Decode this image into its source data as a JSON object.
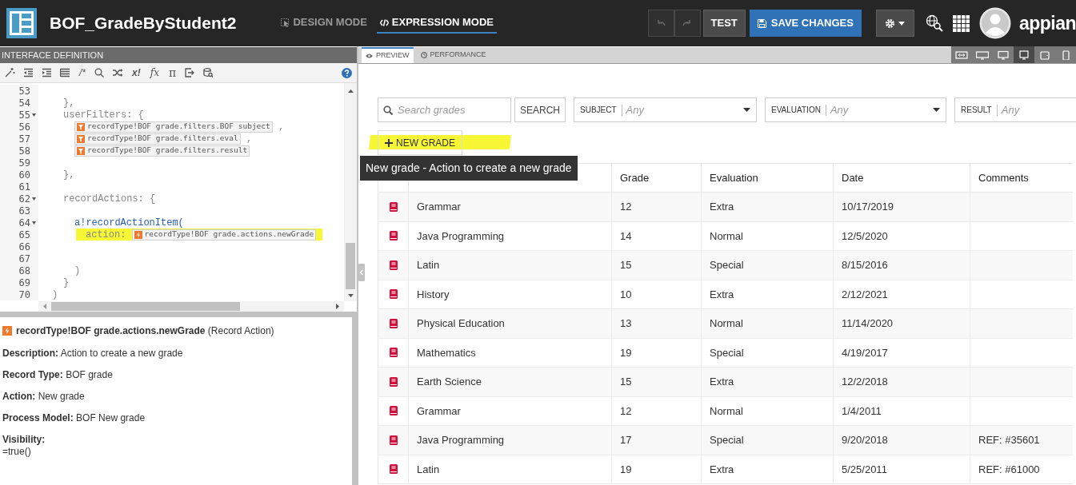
{
  "header": {
    "title": "BOF_GradeByStudent2",
    "modes": [
      {
        "label": "DESIGN MODE",
        "selected": false
      },
      {
        "label": "EXPRESSION MODE",
        "selected": true
      }
    ],
    "undo": {
      "disabled": true
    },
    "redo": {
      "disabled": true
    },
    "test_button": "TEST",
    "save_button": "SAVE CHANGES",
    "brand": "appian"
  },
  "editor": {
    "title": "INTERFACE DEFINITION",
    "toolbar_symbols": [
      "/*",
      "x!",
      "fx",
      "π"
    ],
    "lines": [
      {
        "kind": "block",
        "children": [
          {
            "kind": "line",
            "number": "53",
            "fold": false,
            "highlighted": false
          },
          {
            "kind": "line",
            "number": "54",
            "fold": false,
            "highlighted": false,
            "parts": [
              {
                "kind": "text",
                "text": "},"
              }
            ]
          },
          {
            "kind": "line",
            "number": "55",
            "fold": true,
            "highlighted": false,
            "parts": [
              {
                "kind": "text",
                "text": "userFilters: {"
              }
            ]
          },
          {
            "kind": "block",
            "children": [
              {
                "kind": "line",
                "number": "56",
                "fold": false,
                "highlighted": false,
                "parts": [
                  {
                    "kind": "filter-chip",
                    "text": "recordType!BOF grade.filters.BOF subject"
                  },
                  {
                    "kind": "text",
                    "text": " ,"
                  }
                ]
              },
              {
                "kind": "line",
                "number": "57",
                "fold": false,
                "highlighted": false,
                "parts": [
                  {
                    "kind": "filter-chip",
                    "text": "recordType!BOF grade.filters.eval"
                  },
                  {
                    "kind": "text",
                    "text": " ,"
                  }
                ]
              },
              {
                "kind": "line",
                "number": "58",
                "fold": false,
                "highlighted": false,
                "parts": [
                  {
                    "kind": "filter-chip",
                    "text": "recordType!BOF grade.filters.result"
                  }
                ]
              }
            ]
          },
          {
            "kind": "line",
            "number": "59",
            "fold": false,
            "highlighted": false
          },
          {
            "kind": "line",
            "number": "60",
            "fold": false,
            "highlighted": false,
            "parts": [
              {
                "kind": "text",
                "text": "},"
              }
            ]
          },
          {
            "kind": "line",
            "number": "61",
            "fold": false,
            "highlighted": false
          },
          {
            "kind": "line",
            "number": "62",
            "fold": true,
            "highlighted": false,
            "parts": [
              {
                "kind": "text",
                "text": "recordActions: {"
              }
            ]
          },
          {
            "kind": "line",
            "number": "63",
            "fold": false,
            "highlighted": false
          },
          {
            "kind": "block",
            "children": [
              {
                "kind": "line",
                "number": "64",
                "fold": true,
                "highlighted": false,
                "parts": [
                  {
                    "kind": "function",
                    "text": "a!recordActionItem("
                  }
                ]
              },
              {
                "kind": "block",
                "children": [
                  {
                    "kind": "line",
                    "number": "65",
                    "fold": false,
                    "highlighted": true,
                    "parts": [
                      {
                        "kind": "text",
                        "text": "action: "
                      },
                      {
                        "kind": "action-chip",
                        "text": "recordType!BOF grade.actions.newGrade"
                      }
                    ]
                  }
                ]
              },
              {
                "kind": "line",
                "number": "66",
                "fold": false,
                "highlighted": false
              },
              {
                "kind": "line",
                "number": "67",
                "fold": false,
                "highlighted": false
              },
              {
                "kind": "line",
                "number": "68",
                "fold": false,
                "highlighted": false,
                "parts": [
                  {
                    "kind": "text",
                    "text": ")"
                  }
                ]
              }
            ]
          },
          {
            "kind": "line",
            "number": "69",
            "fold": false,
            "highlighted": false,
            "parts": [
              {
                "kind": "text",
                "text": "}"
              }
            ]
          }
        ]
      },
      {
        "kind": "line",
        "number": "70",
        "fold": false,
        "highlighted": false,
        "parts": [
          {
            "kind": "text",
            "text": ")"
          }
        ]
      }
    ]
  },
  "details": {
    "name": "recordType!BOF grade.actions.newGrade",
    "type": "(Record Action)",
    "fields": [
      {
        "kind": "inline",
        "label": "Description:",
        "value": "Action to create a new grade"
      },
      {
        "kind": "inline",
        "label": "Record Type:",
        "value": "BOF grade"
      },
      {
        "kind": "inline",
        "label": "Action:",
        "value": "New grade"
      },
      {
        "kind": "inline",
        "label": "Process Model:",
        "value": "BOF New grade"
      },
      {
        "kind": "block",
        "label": "Visibility:",
        "value": "=true()"
      }
    ]
  },
  "preview": {
    "tabs": [
      {
        "label": "PREVIEW",
        "selected": true,
        "kind": "eye"
      },
      {
        "label": "PERFORMANCE",
        "selected": false,
        "kind": "clock"
      }
    ],
    "devices": [
      {
        "kind": "fit",
        "selected": false
      },
      {
        "kind": "wide",
        "selected": false
      },
      {
        "kind": "desktop",
        "selected": false
      },
      {
        "kind": "monitor",
        "selected": true
      },
      {
        "kind": "tablet",
        "selected": false
      },
      {
        "kind": "phone",
        "selected": false
      }
    ],
    "search": {
      "placeholder": "Search grades",
      "button": "SEARCH"
    },
    "dropdowns": [
      {
        "label": "SUBJECT",
        "placeholder": "Any",
        "caret": true
      },
      {
        "label": "EVALUATION",
        "placeholder": "Any",
        "caret": true
      },
      {
        "label": "RESULT",
        "placeholder": "Any",
        "caret": false
      }
    ],
    "new_button": {
      "label": "NEW GRADE",
      "highlighted": true
    },
    "tooltip": "New grade - Action to create a new grade",
    "table": {
      "columns": [
        "Grade",
        "Evaluation",
        "Date",
        "Comments"
      ],
      "rows": [
        {
          "subject": "Grammar",
          "grade": "12",
          "evaluation": "Extra",
          "date": "10/17/2019"
        },
        {
          "subject": "Java Programming",
          "grade": "14",
          "evaluation": "Normal",
          "date": "12/5/2020"
        },
        {
          "subject": "Latin",
          "grade": "15",
          "evaluation": "Special",
          "date": "8/15/2016"
        },
        {
          "subject": "History",
          "grade": "10",
          "evaluation": "Extra",
          "date": "2/12/2021"
        },
        {
          "subject": "Physical Education",
          "grade": "13",
          "evaluation": "Normal",
          "date": "11/14/2020"
        },
        {
          "subject": "Mathematics",
          "grade": "19",
          "evaluation": "Special",
          "date": "4/19/2017"
        },
        {
          "subject": "Earth Science",
          "grade": "15",
          "evaluation": "Extra",
          "date": "12/2/2018"
        },
        {
          "subject": "Grammar",
          "grade": "12",
          "evaluation": "Normal",
          "date": "1/4/2011"
        },
        {
          "subject": "Java Programming",
          "grade": "17",
          "evaluation": "Special",
          "date": "9/20/2018",
          "comments": "REF: #35601"
        },
        {
          "subject": "Latin",
          "grade": "19",
          "evaluation": "Extra",
          "date": "5/25/2011",
          "comments": "REF: #61000"
        }
      ]
    }
  }
}
